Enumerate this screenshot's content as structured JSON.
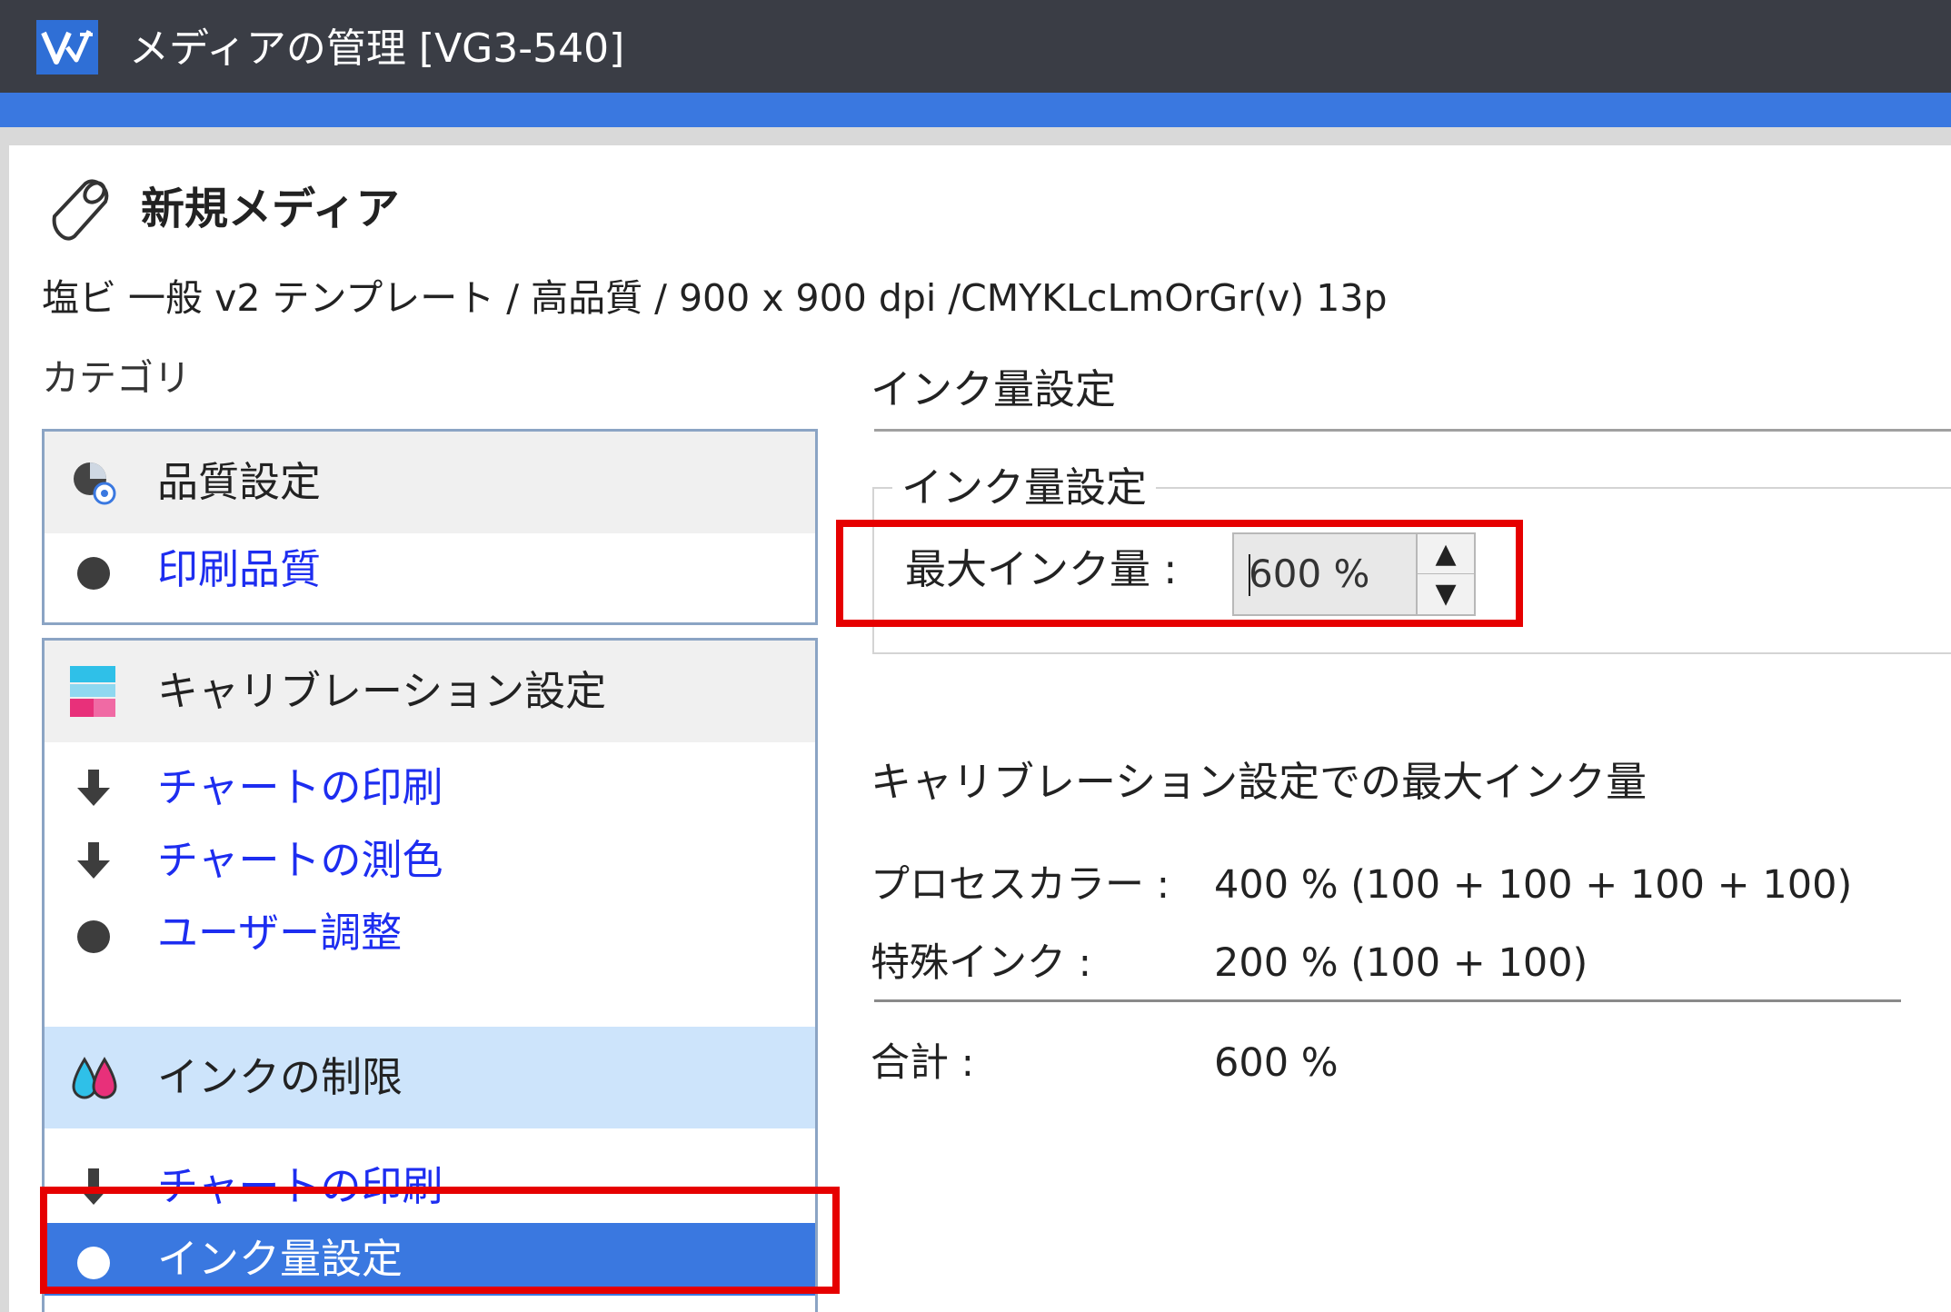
{
  "window": {
    "title": "メディアの管理 [VG3-540]",
    "logo_icon": "app-logo-icon"
  },
  "header": {
    "icon": "media-roll-icon",
    "title": "新規メディア",
    "description": "塩ビ 一般 v2 テンプレート / 高品質 / 900 x 900 dpi /CMYKLcLmOrGr(v) 13p"
  },
  "sidebar": {
    "label": "カテゴリ",
    "groups": [
      {
        "title": "品質設定",
        "icon": "quality-settings-icon",
        "items": [
          {
            "label": "印刷品質",
            "icon": "bullet-icon"
          }
        ]
      },
      {
        "title": "キャリブレーション設定",
        "icon": "calibration-settings-icon",
        "items": [
          {
            "label": "チャートの印刷",
            "icon": "arrow-down-icon"
          },
          {
            "label": "チャートの測色",
            "icon": "arrow-down-icon"
          },
          {
            "label": "ユーザー調整",
            "icon": "bullet-icon"
          }
        ]
      },
      {
        "title": "インクの制限",
        "icon": "ink-drops-icon",
        "active": true,
        "items": [
          {
            "label": "チャートの印刷",
            "icon": "arrow-down-icon"
          },
          {
            "label": "インク量設定",
            "icon": "bullet-icon",
            "selected": true
          }
        ]
      }
    ]
  },
  "main": {
    "section_title": "インク量設定",
    "group_legend": "インク量設定",
    "max_ink_label": "最大インク量 :",
    "max_ink_value": "600 %",
    "spin_up": "▲",
    "spin_down": "▼",
    "calibration_title": "キャリブレーション設定での最大インク量",
    "rows": [
      {
        "label": "プロセスカラー :",
        "value": "400 % (100 + 100 + 100 + 100)"
      },
      {
        "label": "特殊インク :",
        "value": "200 % (100 + 100)"
      }
    ],
    "total": {
      "label": "合計 :",
      "value": "600 %"
    }
  },
  "colors": {
    "titlebar": "#3a3d45",
    "accent": "#3a78e0",
    "link": "#1d2df0",
    "highlight": "#e60000",
    "selected": "#3a78e0"
  }
}
